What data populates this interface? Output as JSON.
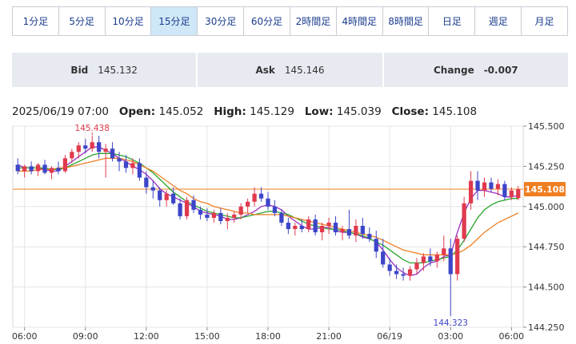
{
  "tabs": [
    {
      "label": "1分足",
      "active": false
    },
    {
      "label": "5分足",
      "active": false
    },
    {
      "label": "10分足",
      "active": false
    },
    {
      "label": "15分足",
      "active": true
    },
    {
      "label": "30分足",
      "active": false
    },
    {
      "label": "60分足",
      "active": false
    },
    {
      "label": "2時間足",
      "active": false
    },
    {
      "label": "4時間足",
      "active": false
    },
    {
      "label": "8時間足",
      "active": false
    },
    {
      "label": "日足",
      "active": false
    },
    {
      "label": "週足",
      "active": false
    },
    {
      "label": "月足",
      "active": false
    }
  ],
  "quote": {
    "bid_label": "Bid",
    "bid": "145.132",
    "ask_label": "Ask",
    "ask": "145.146",
    "change_label": "Change",
    "change": "-0.007"
  },
  "ohlc": {
    "datetime": "2025/06/19 07:00",
    "open_label": "Open:",
    "open": "145.052",
    "high_label": "High:",
    "high": "145.129",
    "low_label": "Low:",
    "low": "145.039",
    "close_label": "Close:",
    "close": "145.108"
  },
  "colors": {
    "up": "#e03a4e",
    "down": "#3d45c8",
    "ma_short": "#9b2fc0",
    "ma_mid": "#2aa52e",
    "ma_long": "#ef7f22",
    "price_line": "#ef7f22",
    "grid": "#e4e4e4",
    "tab_active_bg": "#cfe7f7"
  },
  "chart_data": {
    "type": "candlestick",
    "ylim": [
      144.25,
      145.5
    ],
    "yticks": [
      "145.500",
      "145.250",
      "145.000",
      "144.750",
      "144.500",
      "144.250"
    ],
    "xticks": [
      "06:00",
      "09:00",
      "12:00",
      "15:00",
      "18:00",
      "21:00",
      "06/19",
      "03:00",
      "06:00"
    ],
    "current_price": "145.108",
    "max_label": "145.438",
    "min_label": "144.323",
    "grid": true,
    "bar_interval": "15分",
    "series": [
      {
        "name": "short",
        "values": [
          145.26,
          145.24,
          145.24,
          145.24,
          145.23,
          145.22,
          145.22,
          145.25,
          145.28,
          145.31,
          145.34,
          145.37,
          145.37,
          145.35,
          145.33,
          145.3,
          145.28,
          145.25,
          145.23,
          145.2,
          145.16,
          145.11,
          145.08,
          145.06,
          145.04,
          145.02,
          145.0,
          144.97,
          144.96,
          144.95,
          144.94,
          144.92,
          144.92,
          144.93,
          144.95,
          144.97,
          145.0,
          145.01,
          145.0,
          144.98,
          144.94,
          144.91,
          144.88,
          144.86,
          144.86,
          144.87,
          144.87,
          144.85,
          144.84,
          144.84,
          144.83,
          144.81,
          144.8,
          144.78,
          144.73,
          144.67,
          144.62,
          144.59,
          144.57,
          144.58,
          144.62,
          144.65,
          144.66,
          144.69,
          144.7,
          144.84,
          144.96,
          145.05,
          145.1,
          145.1,
          145.09,
          145.08,
          145.06,
          145.06,
          145.07
        ]
      },
      {
        "name": "mid",
        "values": [
          145.24,
          145.24,
          145.24,
          145.24,
          145.24,
          145.23,
          145.23,
          145.24,
          145.26,
          145.28,
          145.3,
          145.32,
          145.33,
          145.33,
          145.33,
          145.32,
          145.31,
          145.29,
          145.27,
          145.24,
          145.21,
          145.17,
          145.13,
          145.09,
          145.06,
          145.03,
          145.01,
          144.99,
          144.97,
          144.96,
          144.95,
          144.94,
          144.93,
          144.93,
          144.94,
          144.95,
          144.96,
          144.97,
          144.97,
          144.96,
          144.95,
          144.93,
          144.91,
          144.89,
          144.88,
          144.87,
          144.86,
          144.86,
          144.85,
          144.84,
          144.83,
          144.82,
          144.8,
          144.78,
          144.76,
          144.73,
          144.7,
          144.67,
          144.65,
          144.65,
          144.65,
          144.66,
          144.67,
          144.68,
          144.69,
          144.73,
          144.79,
          144.86,
          144.93,
          144.98,
          145.01,
          145.03,
          145.04,
          145.05,
          145.05
        ]
      },
      {
        "name": "long",
        "values": [
          145.22,
          145.22,
          145.22,
          145.23,
          145.23,
          145.23,
          145.24,
          145.24,
          145.25,
          145.26,
          145.27,
          145.28,
          145.29,
          145.3,
          145.3,
          145.3,
          145.29,
          145.28,
          145.26,
          145.24,
          145.22,
          145.19,
          145.16,
          145.13,
          145.1,
          145.08,
          145.05,
          145.03,
          145.02,
          145.0,
          144.99,
          144.98,
          144.97,
          144.96,
          144.96,
          144.95,
          144.95,
          144.95,
          144.95,
          144.95,
          144.94,
          144.93,
          144.92,
          144.91,
          144.9,
          144.89,
          144.88,
          144.87,
          144.86,
          144.85,
          144.84,
          144.83,
          144.82,
          144.81,
          144.79,
          144.77,
          144.75,
          144.73,
          144.72,
          144.71,
          144.7,
          144.7,
          144.7,
          144.7,
          144.7,
          144.71,
          144.73,
          144.76,
          144.8,
          144.84,
          144.87,
          144.9,
          144.92,
          144.94,
          144.96
        ]
      }
    ],
    "candles": [
      {
        "o": 145.26,
        "h": 145.3,
        "l": 145.2,
        "c": 145.22
      },
      {
        "o": 145.22,
        "h": 145.26,
        "l": 145.18,
        "c": 145.25
      },
      {
        "o": 145.25,
        "h": 145.28,
        "l": 145.2,
        "c": 145.22
      },
      {
        "o": 145.22,
        "h": 145.27,
        "l": 145.19,
        "c": 145.26
      },
      {
        "o": 145.26,
        "h": 145.29,
        "l": 145.2,
        "c": 145.21
      },
      {
        "o": 145.21,
        "h": 145.25,
        "l": 145.17,
        "c": 145.24
      },
      {
        "o": 145.24,
        "h": 145.28,
        "l": 145.2,
        "c": 145.22
      },
      {
        "o": 145.22,
        "h": 145.32,
        "l": 145.21,
        "c": 145.3
      },
      {
        "o": 145.3,
        "h": 145.36,
        "l": 145.27,
        "c": 145.34
      },
      {
        "o": 145.34,
        "h": 145.4,
        "l": 145.3,
        "c": 145.38
      },
      {
        "o": 145.38,
        "h": 145.42,
        "l": 145.33,
        "c": 145.36
      },
      {
        "o": 145.36,
        "h": 145.44,
        "l": 145.34,
        "c": 145.4
      },
      {
        "o": 145.4,
        "h": 145.44,
        "l": 145.3,
        "c": 145.34
      },
      {
        "o": 145.34,
        "h": 145.39,
        "l": 145.18,
        "c": 145.36
      },
      {
        "o": 145.36,
        "h": 145.4,
        "l": 145.28,
        "c": 145.3
      },
      {
        "o": 145.3,
        "h": 145.34,
        "l": 145.22,
        "c": 145.28
      },
      {
        "o": 145.28,
        "h": 145.32,
        "l": 145.21,
        "c": 145.24
      },
      {
        "o": 145.24,
        "h": 145.3,
        "l": 145.2,
        "c": 145.27
      },
      {
        "o": 145.27,
        "h": 145.3,
        "l": 145.16,
        "c": 145.18
      },
      {
        "o": 145.18,
        "h": 145.22,
        "l": 145.08,
        "c": 145.12
      },
      {
        "o": 145.12,
        "h": 145.16,
        "l": 145.05,
        "c": 145.1
      },
      {
        "o": 145.1,
        "h": 145.12,
        "l": 145.0,
        "c": 145.04
      },
      {
        "o": 145.04,
        "h": 145.1,
        "l": 145.0,
        "c": 145.08
      },
      {
        "o": 145.08,
        "h": 145.12,
        "l": 145.01,
        "c": 145.02
      },
      {
        "o": 145.02,
        "h": 145.05,
        "l": 144.92,
        "c": 144.94
      },
      {
        "o": 144.94,
        "h": 145.06,
        "l": 144.92,
        "c": 145.04
      },
      {
        "o": 145.04,
        "h": 145.07,
        "l": 144.96,
        "c": 144.98
      },
      {
        "o": 144.98,
        "h": 145.0,
        "l": 144.92,
        "c": 144.95
      },
      {
        "o": 144.95,
        "h": 144.99,
        "l": 144.91,
        "c": 144.93
      },
      {
        "o": 144.93,
        "h": 144.98,
        "l": 144.9,
        "c": 144.96
      },
      {
        "o": 144.96,
        "h": 144.99,
        "l": 144.89,
        "c": 144.91
      },
      {
        "o": 144.91,
        "h": 144.96,
        "l": 144.86,
        "c": 144.93
      },
      {
        "o": 144.93,
        "h": 144.97,
        "l": 144.9,
        "c": 144.95
      },
      {
        "o": 144.95,
        "h": 145.02,
        "l": 144.92,
        "c": 145.0
      },
      {
        "o": 145.0,
        "h": 145.05,
        "l": 144.96,
        "c": 145.03
      },
      {
        "o": 145.03,
        "h": 145.12,
        "l": 145.0,
        "c": 145.08
      },
      {
        "o": 145.08,
        "h": 145.12,
        "l": 145.03,
        "c": 145.05
      },
      {
        "o": 145.05,
        "h": 145.09,
        "l": 144.98,
        "c": 145.0
      },
      {
        "o": 145.0,
        "h": 145.04,
        "l": 144.94,
        "c": 144.96
      },
      {
        "o": 144.96,
        "h": 144.98,
        "l": 144.88,
        "c": 144.9
      },
      {
        "o": 144.9,
        "h": 144.93,
        "l": 144.83,
        "c": 144.86
      },
      {
        "o": 144.86,
        "h": 144.9,
        "l": 144.82,
        "c": 144.88
      },
      {
        "o": 144.88,
        "h": 144.92,
        "l": 144.84,
        "c": 144.86
      },
      {
        "o": 144.86,
        "h": 144.94,
        "l": 144.84,
        "c": 144.92
      },
      {
        "o": 144.92,
        "h": 144.95,
        "l": 144.82,
        "c": 144.84
      },
      {
        "o": 144.84,
        "h": 144.9,
        "l": 144.79,
        "c": 144.88
      },
      {
        "o": 144.88,
        "h": 144.93,
        "l": 144.83,
        "c": 144.9
      },
      {
        "o": 144.9,
        "h": 144.94,
        "l": 144.82,
        "c": 144.84
      },
      {
        "o": 144.84,
        "h": 144.88,
        "l": 144.79,
        "c": 144.86
      },
      {
        "o": 144.86,
        "h": 144.98,
        "l": 144.8,
        "c": 144.82
      },
      {
        "o": 144.82,
        "h": 144.92,
        "l": 144.78,
        "c": 144.88
      },
      {
        "o": 144.88,
        "h": 144.93,
        "l": 144.8,
        "c": 144.83
      },
      {
        "o": 144.83,
        "h": 144.87,
        "l": 144.78,
        "c": 144.8
      },
      {
        "o": 144.8,
        "h": 144.85,
        "l": 144.68,
        "c": 144.72
      },
      {
        "o": 144.72,
        "h": 144.8,
        "l": 144.62,
        "c": 144.64
      },
      {
        "o": 144.64,
        "h": 144.68,
        "l": 144.57,
        "c": 144.6
      },
      {
        "o": 144.6,
        "h": 144.64,
        "l": 144.55,
        "c": 144.58
      },
      {
        "o": 144.58,
        "h": 144.62,
        "l": 144.54,
        "c": 144.57
      },
      {
        "o": 144.57,
        "h": 144.63,
        "l": 144.54,
        "c": 144.61
      },
      {
        "o": 144.61,
        "h": 144.68,
        "l": 144.58,
        "c": 144.65
      },
      {
        "o": 144.65,
        "h": 144.71,
        "l": 144.6,
        "c": 144.69
      },
      {
        "o": 144.69,
        "h": 144.74,
        "l": 144.63,
        "c": 144.66
      },
      {
        "o": 144.66,
        "h": 144.72,
        "l": 144.62,
        "c": 144.7
      },
      {
        "o": 144.7,
        "h": 144.82,
        "l": 144.66,
        "c": 144.74
      },
      {
        "o": 144.74,
        "h": 144.8,
        "l": 144.32,
        "c": 144.58
      },
      {
        "o": 144.58,
        "h": 144.82,
        "l": 144.54,
        "c": 144.8
      },
      {
        "o": 144.8,
        "h": 145.06,
        "l": 144.78,
        "c": 145.02
      },
      {
        "o": 145.02,
        "h": 145.22,
        "l": 144.98,
        "c": 145.16
      },
      {
        "o": 145.16,
        "h": 145.22,
        "l": 145.04,
        "c": 145.1
      },
      {
        "o": 145.1,
        "h": 145.18,
        "l": 145.06,
        "c": 145.15
      },
      {
        "o": 145.15,
        "h": 145.18,
        "l": 145.09,
        "c": 145.11
      },
      {
        "o": 145.11,
        "h": 145.17,
        "l": 145.07,
        "c": 145.14
      },
      {
        "o": 145.14,
        "h": 145.16,
        "l": 145.04,
        "c": 145.06
      },
      {
        "o": 145.06,
        "h": 145.12,
        "l": 145.04,
        "c": 145.1
      },
      {
        "o": 145.052,
        "h": 145.129,
        "l": 145.039,
        "c": 145.108
      }
    ]
  }
}
